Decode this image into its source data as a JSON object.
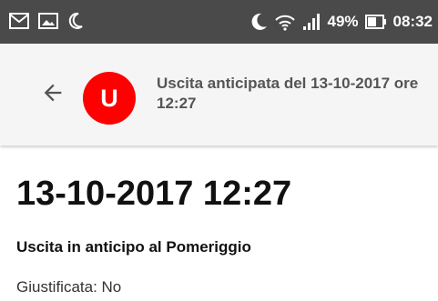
{
  "status_bar": {
    "battery": "49%",
    "time": "08:32"
  },
  "app_bar": {
    "avatar_letter": "U",
    "title": "Uscita anticipata del 13-10-2017 ore 12:27"
  },
  "content": {
    "date_time": "13-10-2017 12:27",
    "type": "Uscita in anticipo al Pomeriggio",
    "justified": "Giustificata: No"
  },
  "colors": {
    "avatar": "#ff0000",
    "status_bar": "#4a4a4a",
    "app_bar": "#f5f5f5"
  },
  "icons": {
    "status_left": [
      "mail-icon",
      "image-icon",
      "night-mode-icon"
    ],
    "status_right": [
      "moon-icon",
      "wifi-icon",
      "signal-icon",
      "battery-icon"
    ],
    "app_bar": [
      "back-arrow-icon"
    ]
  }
}
